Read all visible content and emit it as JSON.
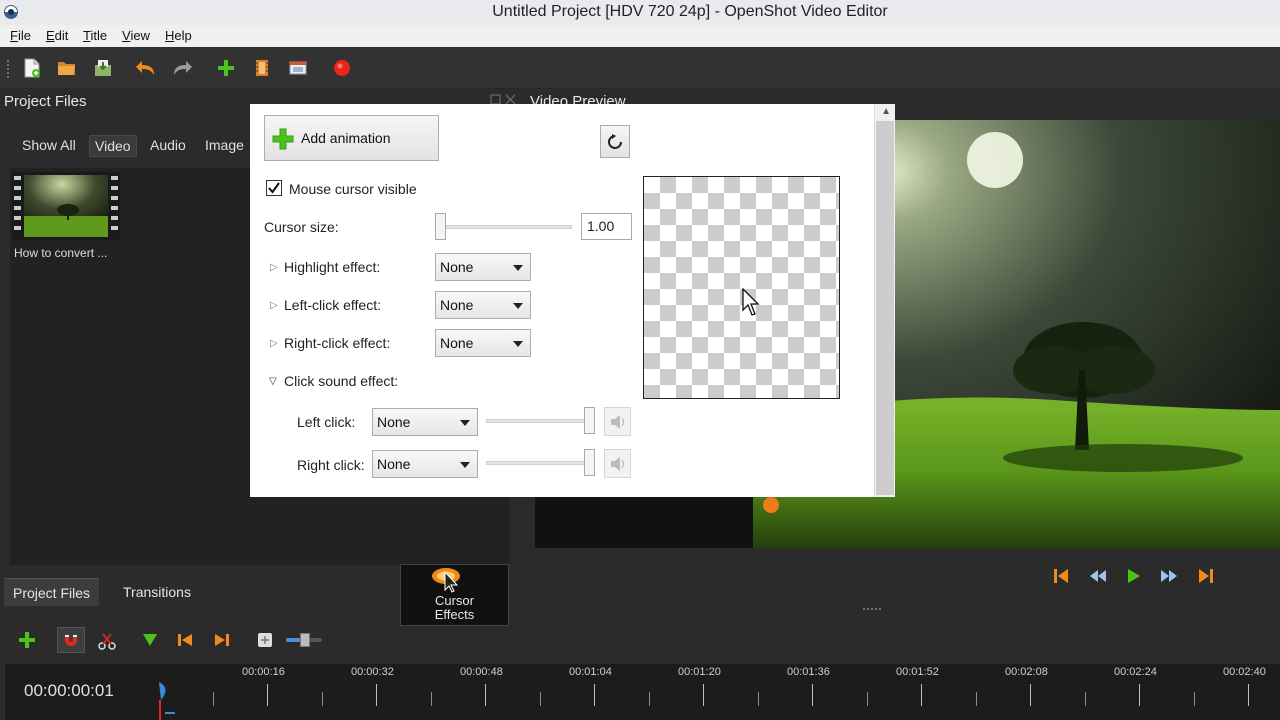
{
  "window": {
    "title": "Untitled Project [HDV 720 24p] - OpenShot Video Editor"
  },
  "menubar": {
    "items": [
      "File",
      "Edit",
      "Title",
      "View",
      "Help"
    ]
  },
  "toolbar": {
    "icons": [
      "new-project-icon",
      "open-project-icon",
      "save-project-icon",
      "undo-icon",
      "redo-icon",
      "import-files-icon",
      "profile-icon",
      "fullscreen-icon",
      "export-video-icon"
    ],
    "colors": {
      "record": "#e8261c",
      "undo": "#f08a1c",
      "add": "#4cc21c"
    }
  },
  "project_files": {
    "title": "Project Files",
    "filters": [
      "Show All",
      "Video",
      "Audio",
      "Image"
    ],
    "active_filter": "Video",
    "files": [
      {
        "name": "How to convert ..."
      }
    ]
  },
  "bottom_tabs": {
    "items": [
      "Project Files",
      "Transitions"
    ],
    "active": "Project Files"
  },
  "cursor_effects": {
    "label_line1": "Cursor",
    "label_line2": "Effects"
  },
  "video_preview": {
    "title": "Video Preview"
  },
  "timeline": {
    "timecode": "00:00:00:01",
    "ticks": [
      "00:00:16",
      "00:00:32",
      "00:00:48",
      "00:01:04",
      "00:01:20",
      "00:01:36",
      "00:01:52",
      "00:02:08",
      "00:02:24",
      "00:02:40"
    ],
    "zoom_level": 0.18
  },
  "dialog": {
    "add_animation_label": "Add animation",
    "mouse_cursor_visible_label": "Mouse cursor visible",
    "mouse_cursor_visible_checked": true,
    "cursor_size_label": "Cursor size:",
    "cursor_size_value": "1.00",
    "cursor_size_level": 0.0,
    "highlight_label": "Highlight effect:",
    "highlight_value": "None",
    "left_click_effect_label": "Left-click effect:",
    "left_click_effect_value": "None",
    "right_click_effect_label": "Right-click effect:",
    "right_click_effect_value": "None",
    "click_sound_label": "Click sound effect:",
    "left_click_label": "Left click:",
    "left_click_sound": "None",
    "left_click_volume": 1.0,
    "right_click_label": "Right click:",
    "right_click_sound": "None",
    "right_click_volume": 1.0
  }
}
